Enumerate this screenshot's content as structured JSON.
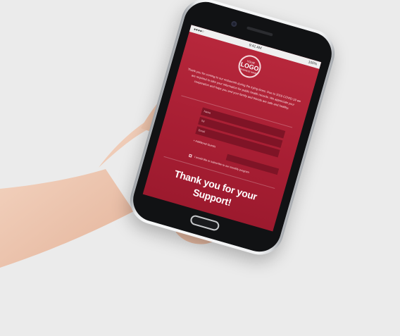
{
  "status_bar": {
    "signal": "●●●●○",
    "time": "9:41 AM",
    "battery": "100%"
  },
  "logo": {
    "top": "YOUR",
    "main": "LOGO",
    "bottom": "BUSINESS NAME"
  },
  "message": "Thank you for coming to our restaurant during the trying times. Due to 2019 COVID-19 we are required to take your information for public health records. We appreciate your cooperation and hope you and your family and friends are safe and healthy.",
  "form": {
    "fields": [
      "Name",
      "Tel",
      "Email"
    ],
    "additional_guests_label": "Additional Guests",
    "consent_label": "I would like to subscribe to our monthly program"
  },
  "footer_message": "Thank you for your Support!",
  "colors": {
    "screen_red": "#b8283c",
    "field_red": "#7f1426",
    "background": "#ebebeb"
  }
}
